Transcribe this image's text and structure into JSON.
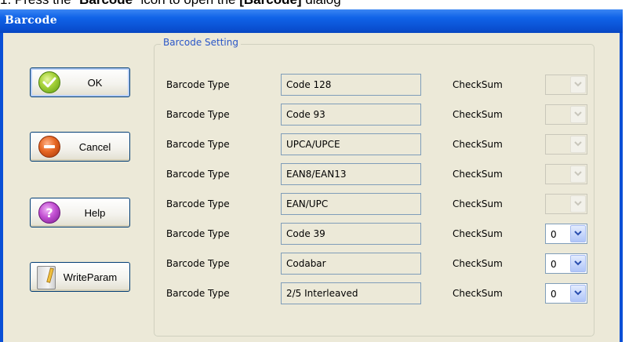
{
  "caption": {
    "prefix": "1. Press the “",
    "icon_name": "Barcode",
    "middle": "” icon to open the ",
    "dialog_name": "[Barcode]",
    "suffix": " dialog"
  },
  "window": {
    "title": "Barcode"
  },
  "buttons": {
    "ok": "OK",
    "cancel": "Cancel",
    "help": "Help",
    "write_param": "WriteParam"
  },
  "group": {
    "title": "Barcode Setting"
  },
  "rows": [
    {
      "label": "Barcode Type",
      "type": "Code 128",
      "checksum_label": "CheckSum",
      "checksum_value": "",
      "enabled": false
    },
    {
      "label": "Barcode Type",
      "type": "Code 93",
      "checksum_label": "CheckSum",
      "checksum_value": "",
      "enabled": false
    },
    {
      "label": "Barcode Type",
      "type": "UPCA/UPCE",
      "checksum_label": "CheckSum",
      "checksum_value": "",
      "enabled": false
    },
    {
      "label": "Barcode Type",
      "type": "EAN8/EAN13",
      "checksum_label": "CheckSum",
      "checksum_value": "",
      "enabled": false
    },
    {
      "label": "Barcode Type",
      "type": "EAN/UPC",
      "checksum_label": "CheckSum",
      "checksum_value": "",
      "enabled": false
    },
    {
      "label": "Barcode Type",
      "type": "Code 39",
      "checksum_label": "CheckSum",
      "checksum_value": "0",
      "enabled": true
    },
    {
      "label": "Barcode Type",
      "type": "Codabar",
      "checksum_label": "CheckSum",
      "checksum_value": "0",
      "enabled": true
    },
    {
      "label": "Barcode Type",
      "type": "2/5 Interleaved",
      "checksum_label": "CheckSum",
      "checksum_value": "0",
      "enabled": true
    }
  ],
  "colors": {
    "titlebar": "#0a50d2",
    "dialog_bg": "#ece9d8",
    "group_title": "#2b57c8"
  }
}
